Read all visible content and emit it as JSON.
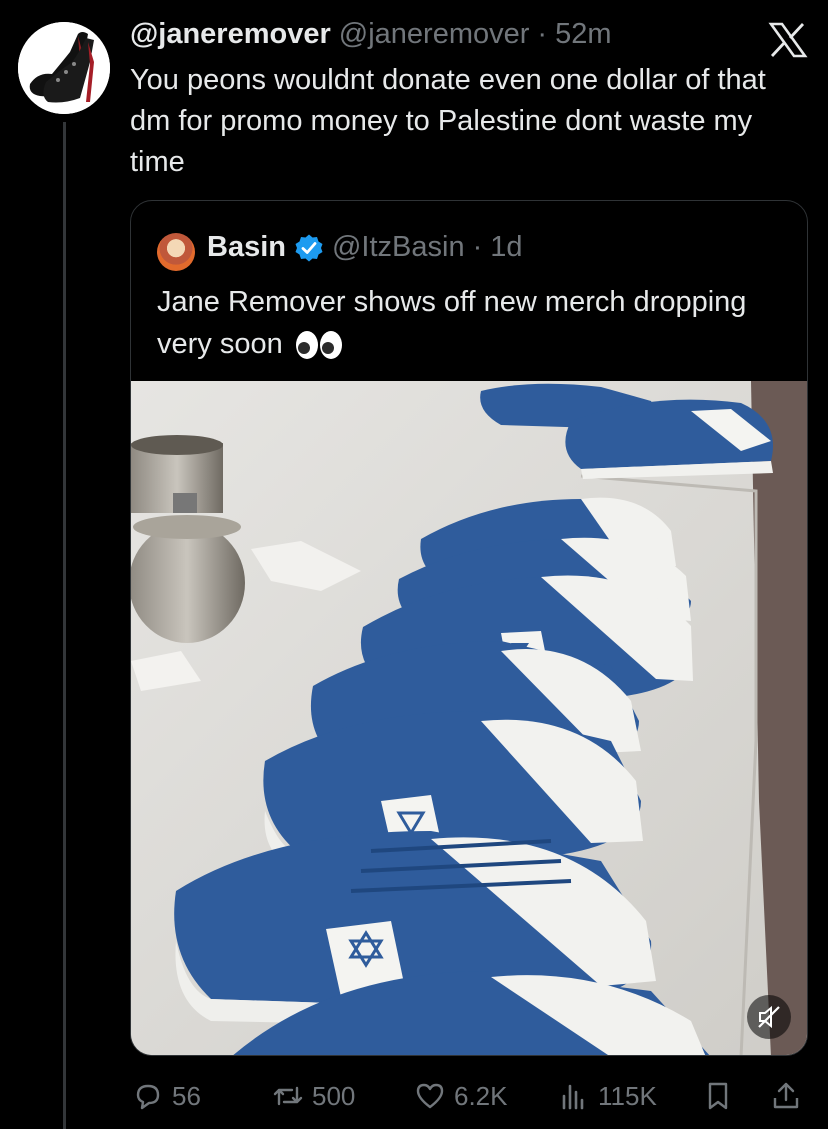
{
  "post": {
    "display_name": "@janeremover",
    "handle": "@janeremover",
    "separator": "·",
    "time": "52m",
    "text": "You peons wouldnt donate even one dollar of that dm for promo money to Palestine dont waste my time"
  },
  "quote": {
    "display_name": "Basin",
    "handle": "@ItzBasin",
    "separator": "·",
    "time": "1d",
    "text": "Jane Remover shows off new merch dropping very soon",
    "emoji": "eyes-emoji"
  },
  "actions": {
    "replies": "56",
    "reposts": "500",
    "likes": "6.2K",
    "views": "115K"
  },
  "icons": {
    "platform": "x-logo-icon",
    "verified": "verified-badge-icon",
    "mute": "muted-speaker-icon",
    "reply": "reply-icon",
    "repost": "repost-icon",
    "like": "heart-icon",
    "views": "views-icon",
    "bookmark": "bookmark-icon",
    "share": "share-icon"
  },
  "colors": {
    "background": "#000000",
    "text": "#e7e9ea",
    "muted": "#71767b",
    "border": "#2f3336",
    "verified": "#1d9bf0",
    "shoe_blue": "#2f5c9c"
  }
}
